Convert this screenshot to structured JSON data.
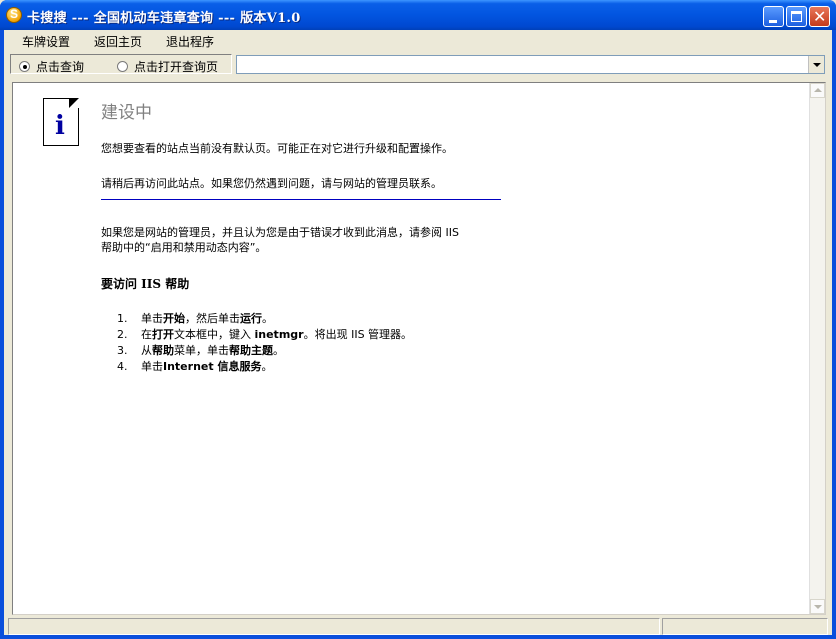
{
  "window": {
    "title": "卡搜搜 --- 全国机动车违章查询 --- 版本V1.0"
  },
  "menu": {
    "items": [
      "车牌设置",
      "返回主页",
      "退出程序"
    ]
  },
  "toolbar": {
    "radio_query": "点击查询",
    "radio_open": "点击打开查询页",
    "selected": "点击查询",
    "url_value": ""
  },
  "page": {
    "title": "建设中",
    "p1": "您想要查看的站点当前没有默认页。可能正在对它进行升级和配置操作。",
    "p2": "请稍后再访问此站点。如果您仍然遇到问题，请与网站的管理员联系。",
    "p3_line1": "如果您是网站的管理员，并且认为您是由于错误才收到此消息，请参阅 IIS",
    "p3_line2": "帮助中的“启用和禁用动态内容”。",
    "help_heading": "要访问 IIS 帮助",
    "steps": [
      {
        "num": "1.",
        "pre": "单击",
        "b1": "开始",
        "mid": "，然后单击",
        "b2": "运行",
        "post": "。"
      },
      {
        "num": "2.",
        "pre": "在",
        "b1": "打开",
        "mid": "文本框中，键入 ",
        "b2": "inetmgr",
        "post": "。将出现 IIS 管理器。"
      },
      {
        "num": "3.",
        "pre": "从",
        "b1": "帮助",
        "mid": "菜单，单击",
        "b2": "帮助主题",
        "post": "。"
      },
      {
        "num": "4.",
        "pre": "单击",
        "b1": "Internet 信息服务",
        "mid": "",
        "b2": "",
        "post": "。"
      }
    ]
  },
  "status": {
    "left": "",
    "right": ""
  }
}
